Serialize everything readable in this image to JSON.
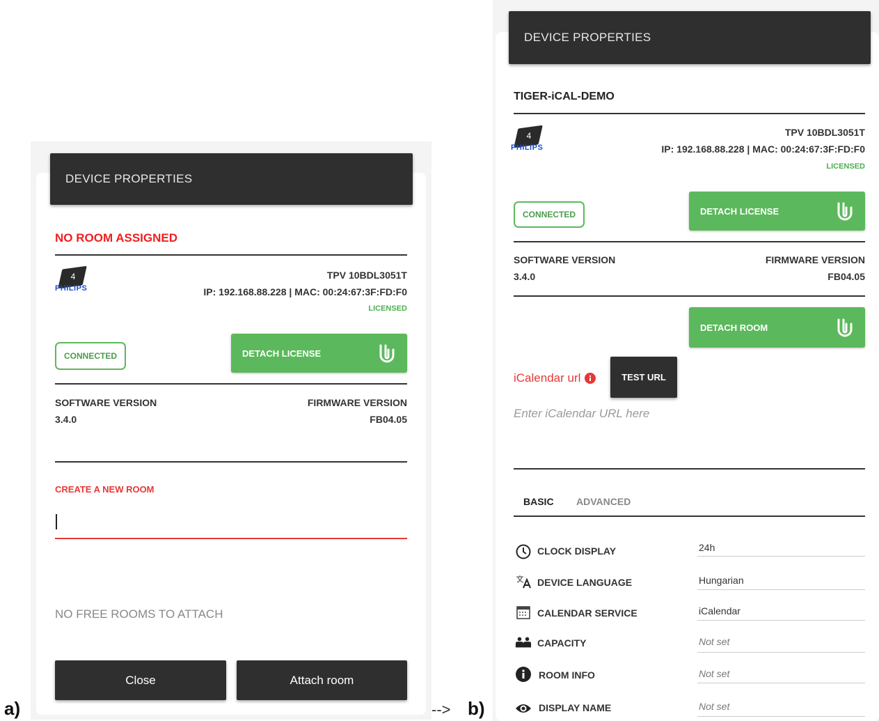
{
  "caption": {
    "a": "a)",
    "arrow": "-->",
    "b": "b)"
  },
  "panel_a": {
    "header": "DEVICE PROPERTIES",
    "status_title": "NO ROOM ASSIGNED",
    "device": {
      "chip_number": "4",
      "brand": "PHILIPS",
      "model": "TPV 10BDL3051T",
      "ip_mac": "IP: 192.168.88.228 | MAC: 00:24:67:3F:FD:F0",
      "license": "LICENSED"
    },
    "connected": "CONNECTED",
    "detach_license": "DETACH LICENSE",
    "software_label": "SOFTWARE VERSION",
    "software_value": "3.4.0",
    "firmware_label": "FIRMWARE VERSION",
    "firmware_value": "FB04.05",
    "create_room_label": "CREATE A NEW ROOM",
    "create_room_value": "",
    "no_free_rooms": "NO FREE ROOMS TO ATTACH",
    "close_button": "Close",
    "attach_button": "Attach room"
  },
  "panel_b": {
    "header": "DEVICE PROPERTIES",
    "room_title": "TIGER-iCAL-DEMO",
    "device": {
      "chip_number": "4",
      "brand": "PHILIPS",
      "model": "TPV 10BDL3051T",
      "ip_mac": "IP: 192.168.88.228 | MAC: 00:24:67:3F:FD:F0",
      "license": "LICENSED"
    },
    "connected": "CONNECTED",
    "detach_license": "DETACH LICENSE",
    "software_label": "SOFTWARE VERSION",
    "software_value": "3.4.0",
    "firmware_label": "FIRMWARE VERSION",
    "firmware_value": "FB04.05",
    "detach_room": "DETACH ROOM",
    "ical_label": "iCalendar url",
    "test_url": "TEST URL",
    "ical_placeholder": "Enter iCalendar URL here",
    "tabs": [
      "BASIC",
      "ADVANCED"
    ],
    "settings": [
      {
        "icon": "clock-icon",
        "label": "CLOCK DISPLAY",
        "value": "24h"
      },
      {
        "icon": "translate-icon",
        "label": "DEVICE LANGUAGE",
        "value": "Hungarian"
      },
      {
        "icon": "calendar-icon",
        "label": "CALENDAR SERVICE",
        "value": "iCalendar"
      },
      {
        "icon": "people-icon",
        "label": "CAPACITY",
        "value": "Not set"
      },
      {
        "icon": "info-icon",
        "label": "ROOM INFO",
        "value": "Not set"
      },
      {
        "icon": "eye-icon",
        "label": "DISPLAY NAME",
        "value": "Not set"
      }
    ]
  },
  "colors": {
    "header_bg": "#2f2f2f",
    "accent_green": "#5cb85c",
    "alert_red": "#f21e1e",
    "brand_blue": "#1a4fd1"
  }
}
